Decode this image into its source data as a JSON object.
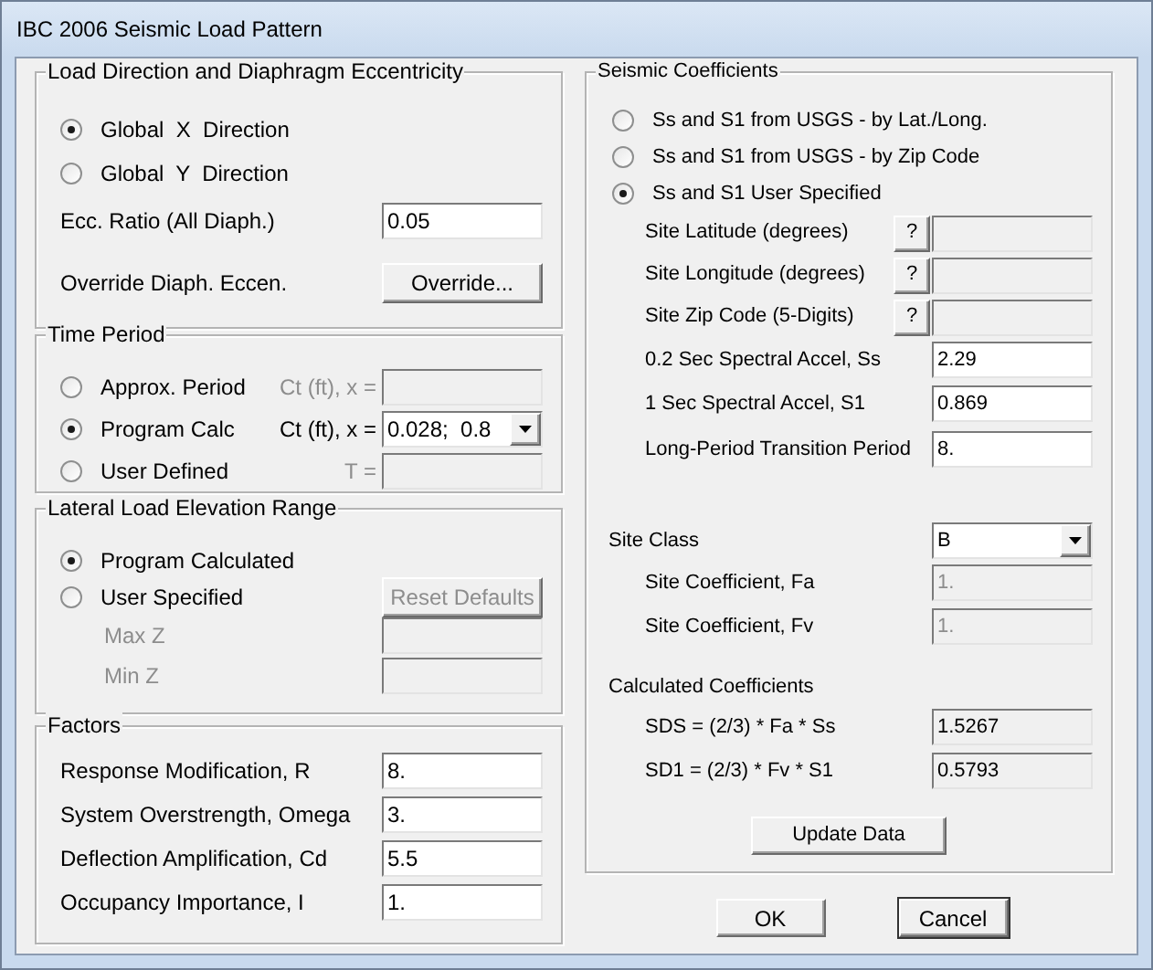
{
  "window": {
    "title": "IBC 2006 Seismic Load Pattern"
  },
  "load_direction": {
    "title": "Load Direction and Diaphragm Eccentricity",
    "options": [
      {
        "label": "Global  X  Direction",
        "selected": true
      },
      {
        "label": "Global  Y  Direction",
        "selected": false
      }
    ],
    "ecc_ratio": {
      "label": "Ecc. Ratio (All Diaph.)",
      "value": "0.05"
    },
    "override": {
      "label": "Override Diaph. Eccen.",
      "button": "Override..."
    }
  },
  "time_period": {
    "title": "Time Period",
    "options": [
      {
        "label": "Approx. Period",
        "selected": false,
        "field_label": "Ct (ft), x =",
        "kind": "text",
        "disabled": true
      },
      {
        "label": "Program Calc",
        "selected": true,
        "field_label": "Ct (ft), x =",
        "kind": "dropdown",
        "value": "0.028;  0.8",
        "disabled": false
      },
      {
        "label": "User Defined",
        "selected": false,
        "field_label": "T =",
        "kind": "text",
        "disabled": true
      }
    ]
  },
  "elevation_range": {
    "title": "Lateral Load Elevation Range",
    "options": [
      {
        "label": "Program Calculated",
        "selected": true
      },
      {
        "label": "User Specified",
        "selected": false
      }
    ],
    "reset_button": {
      "label": "Reset Defaults",
      "disabled": true
    },
    "fields": [
      {
        "label": "Max Z",
        "disabled": true
      },
      {
        "label": "Min Z",
        "disabled": true
      }
    ]
  },
  "factors": {
    "title": "Factors",
    "fields": [
      {
        "label": "Response Modification, R",
        "value": "8."
      },
      {
        "label": "System Overstrength, Omega",
        "value": "3."
      },
      {
        "label": "Deflection Amplification, Cd",
        "value": "5.5"
      },
      {
        "label": "Occupancy Importance, I",
        "value": "1."
      }
    ]
  },
  "seismic_coefficients": {
    "title": "Seismic Coefficients",
    "options": [
      {
        "label": "Ss and S1 from USGS - by Lat./Long.",
        "selected": false
      },
      {
        "label": "Ss and S1 from USGS - by Zip Code",
        "selected": false
      },
      {
        "label": "Ss and S1 User Specified",
        "selected": true
      }
    ],
    "site_fields": [
      {
        "label": "Site Latitude (degrees)",
        "help": "?",
        "disabled": true
      },
      {
        "label": "Site Longitude (degrees)",
        "help": "?",
        "disabled": true
      },
      {
        "label": "Site Zip Code (5-Digits)",
        "help": "?",
        "disabled": true
      }
    ],
    "spectral_fields": [
      {
        "label": "0.2 Sec Spectral Accel, Ss",
        "value": "2.29"
      },
      {
        "label": "1 Sec Spectral Accel, S1",
        "value": "0.869"
      },
      {
        "label": "Long-Period Transition Period",
        "value": "8."
      }
    ],
    "site_class": {
      "label": "Site Class",
      "value": "B"
    },
    "site_coefficients": [
      {
        "label": "Site Coefficient, Fa",
        "value": "1.",
        "disabled": true
      },
      {
        "label": "Site Coefficient, Fv",
        "value": "1.",
        "disabled": true
      }
    ],
    "calculated": {
      "title": "Calculated Coefficients",
      "fields": [
        {
          "label": "SDS = (2/3) * Fa * Ss",
          "value": "1.5267",
          "readonly": true
        },
        {
          "label": "SD1 = (2/3) * Fv * S1",
          "value": "0.5793",
          "readonly": true
        }
      ]
    },
    "update_button": "Update Data"
  },
  "buttons": [
    {
      "label": "OK",
      "focused": false
    },
    {
      "label": "Cancel",
      "focused": true
    }
  ]
}
